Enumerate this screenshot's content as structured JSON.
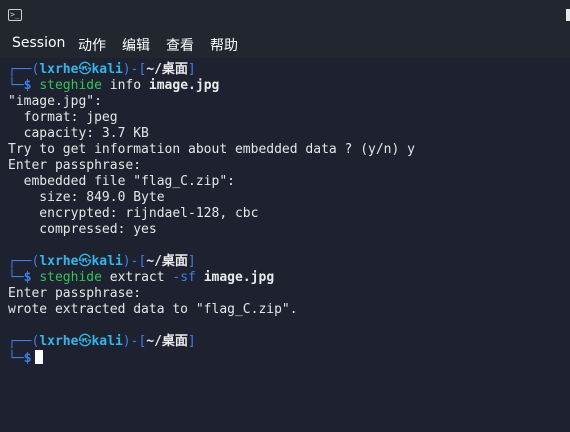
{
  "menu": [
    "Session",
    "动作",
    "编辑",
    "查看",
    "帮助"
  ],
  "prompt": {
    "corner_top": "┌──",
    "open_paren": "(",
    "user": "lxrhe",
    "at": "㉿",
    "host": "kali",
    "close_paren": ")",
    "dash": "-",
    "lbracket": "[",
    "path": "~/桌面",
    "rbracket": "]",
    "corner_bottom": "└─",
    "dollar": "$"
  },
  "commands": {
    "c1_cmd": "steghide",
    "c1_sub": " info ",
    "c1_arg": "image.jpg",
    "c2_cmd": "steghide",
    "c2_sub": " extract ",
    "c2_flag": "-sf ",
    "c2_arg": "image.jpg"
  },
  "output": {
    "o1": "\"image.jpg\":",
    "o2": "  format: jpeg",
    "o3": "  capacity: 3.7 KB",
    "o4": "Try to get information about embedded data ? (y/n) y",
    "o5": "Enter passphrase:",
    "o6": "  embedded file \"flag_C.zip\":",
    "o7": "    size: 849.0 Byte",
    "o8": "    encrypted: rijndael-128, cbc",
    "o9": "    compressed: yes",
    "o10": "Enter passphrase:",
    "o11": "wrote extracted data to \"flag_C.zip\"."
  },
  "colors": {
    "background": "#1e2230",
    "prompt_blue": "#3f7ee8",
    "user_cyan": "#33b7e9",
    "command_green": "#33c45a"
  }
}
